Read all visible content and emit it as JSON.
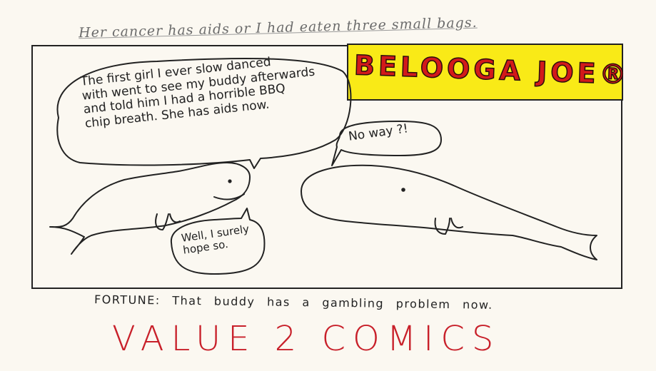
{
  "top_caption": "Her cancer has aids or I had eaten three small bags.",
  "title": "BELOOGA JOE®",
  "bubble_left": {
    "lines": [
      "The first girl I ever slow danced",
      "with went to see my buddy afterwards",
      "and told him I had a horrible BBQ",
      "chip breath. She has aids now."
    ]
  },
  "bubble_right": {
    "text": "No way ?!"
  },
  "bubble_bottom": {
    "lines": [
      "Well, I surely",
      "hope so."
    ]
  },
  "fortune": "FORTUNE: That buddy has a gambling problem now.",
  "footer": "VALUE 2 COMICS",
  "colors": {
    "title_bg": "#f9ea17",
    "title_text": "#d21a1a",
    "footer_text": "#c8202a",
    "ink": "#222222"
  }
}
